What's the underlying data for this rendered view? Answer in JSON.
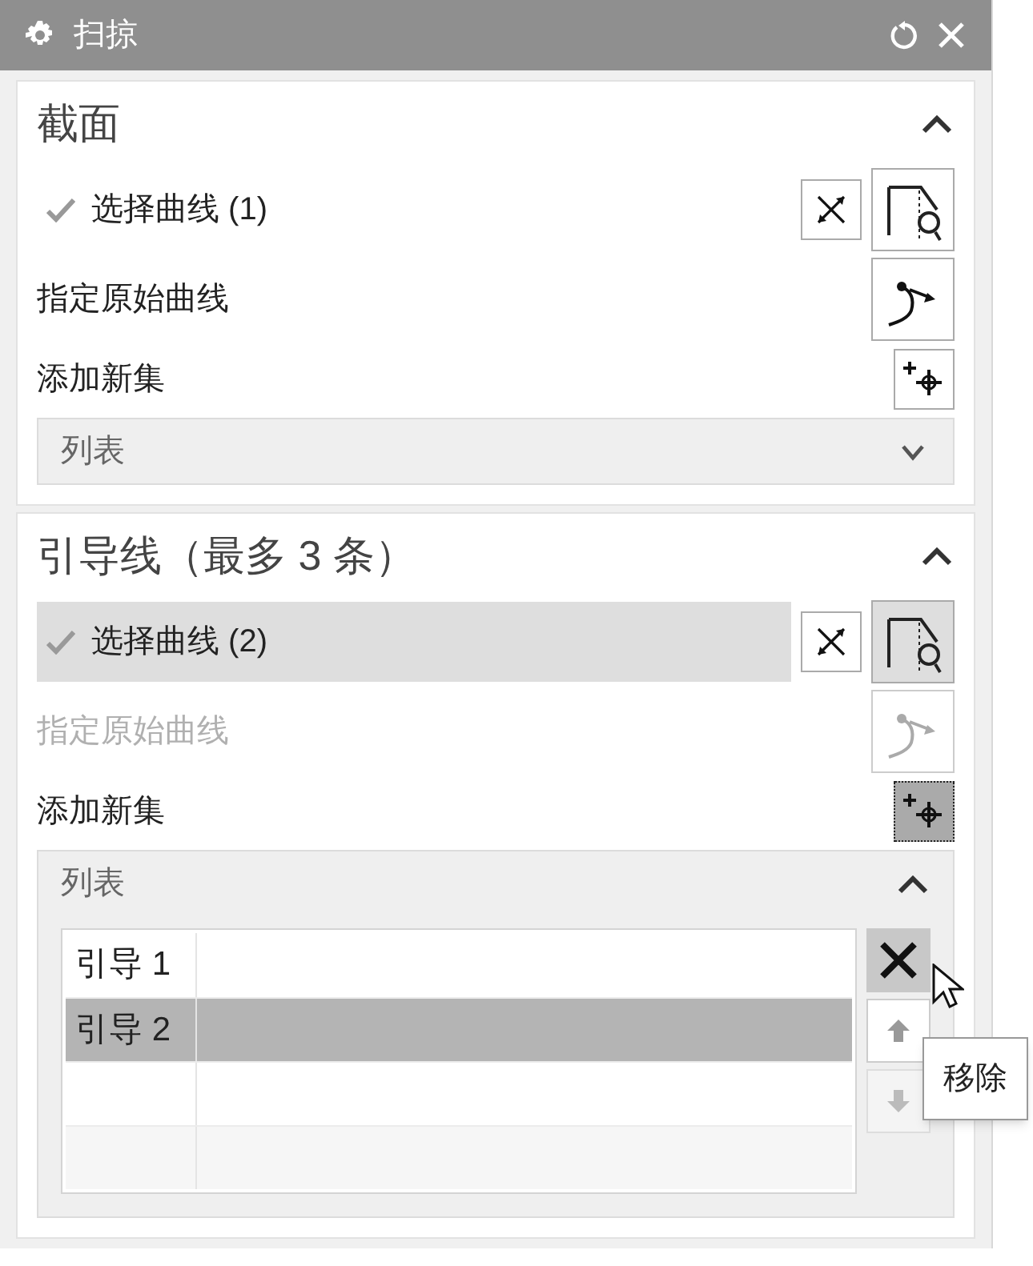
{
  "window": {
    "title": "扫掠"
  },
  "sections": [
    {
      "title": "截面",
      "expanded": true,
      "rows": [
        {
          "kind": "select",
          "label": "选择曲线 (1)",
          "checked": true,
          "selected": false
        },
        {
          "kind": "specify",
          "label": "指定原始曲线",
          "disabled": false
        },
        {
          "kind": "add",
          "label": "添加新集",
          "active": false
        }
      ],
      "list": {
        "label": "列表",
        "expanded": false
      }
    },
    {
      "title": "引导线（最多 3 条）",
      "expanded": true,
      "rows": [
        {
          "kind": "select",
          "label": "选择曲线 (2)",
          "checked": true,
          "selected": true
        },
        {
          "kind": "specify",
          "label": "指定原始曲线",
          "disabled": true
        },
        {
          "kind": "add",
          "label": "添加新集",
          "active": true
        }
      ],
      "list": {
        "label": "列表",
        "expanded": true,
        "items": [
          {
            "label": "引导 1",
            "selected": false
          },
          {
            "label": "引导 2",
            "selected": true
          }
        ],
        "tooltip": "移除"
      }
    }
  ]
}
